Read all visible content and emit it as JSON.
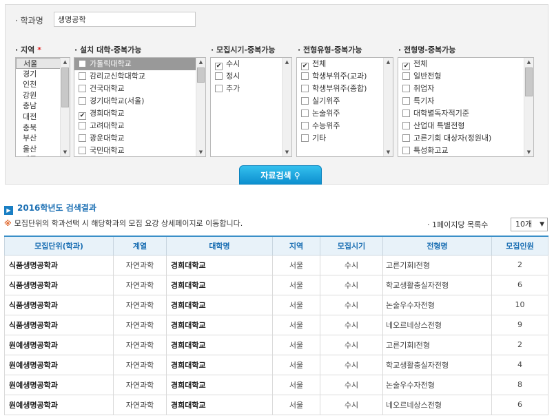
{
  "search": {
    "major_label": "학과명",
    "major_value": "생명공학"
  },
  "filters": {
    "region": {
      "title": "지역",
      "required_mark": "*",
      "items": [
        {
          "label": "서울",
          "selected": true
        },
        {
          "label": "경기",
          "selected": false
        },
        {
          "label": "인천",
          "selected": false
        },
        {
          "label": "강원",
          "selected": false
        },
        {
          "label": "충남",
          "selected": false
        },
        {
          "label": "대전",
          "selected": false
        },
        {
          "label": "충북",
          "selected": false
        },
        {
          "label": "부산",
          "selected": false
        },
        {
          "label": "울산",
          "selected": false
        },
        {
          "label": "대구",
          "selected": false
        }
      ]
    },
    "university": {
      "title": "설치 대학-중복가능",
      "items": [
        {
          "label": "가톨릭대학교",
          "checked": false,
          "highlight": true
        },
        {
          "label": "감리교신학대학교",
          "checked": false
        },
        {
          "label": "건국대학교",
          "checked": false
        },
        {
          "label": "경기대학교(서울)",
          "checked": false
        },
        {
          "label": "경희대학교",
          "checked": true
        },
        {
          "label": "고려대학교",
          "checked": false
        },
        {
          "label": "광운대학교",
          "checked": false
        },
        {
          "label": "국민대학교",
          "checked": false
        }
      ]
    },
    "period": {
      "title": "모집시기-중복가능",
      "items": [
        {
          "label": "수시",
          "checked": true
        },
        {
          "label": "정시",
          "checked": false
        },
        {
          "label": "추가",
          "checked": false
        }
      ]
    },
    "type": {
      "title": "전형유형-중복가능",
      "items": [
        {
          "label": "전체",
          "checked": true
        },
        {
          "label": "학생부위주(교과)",
          "checked": false
        },
        {
          "label": "학생부위주(종합)",
          "checked": false
        },
        {
          "label": "실기위주",
          "checked": false
        },
        {
          "label": "논술위주",
          "checked": false
        },
        {
          "label": "수능위주",
          "checked": false
        },
        {
          "label": "기타",
          "checked": false
        }
      ]
    },
    "name": {
      "title": "전형명-중복가능",
      "items": [
        {
          "label": "전체",
          "checked": true
        },
        {
          "label": "일반전형",
          "checked": false
        },
        {
          "label": "취업자",
          "checked": false
        },
        {
          "label": "특기자",
          "checked": false
        },
        {
          "label": "대학별독자적기준",
          "checked": false
        },
        {
          "label": "산업대 특별전형",
          "checked": false
        },
        {
          "label": "고른기회 대상자(정원내)",
          "checked": false
        },
        {
          "label": "특성화고교",
          "checked": false
        }
      ]
    }
  },
  "search_button": "자료검색",
  "results": {
    "title": "2016학년도 검색결과",
    "notice_mark": "※",
    "notice": "모집단위의 학과선택 시 해당학과의 모집 요강 상세페이지로 이동합니다.",
    "per_page_label": "· 1페이지당 목록수",
    "per_page_value": "10개",
    "columns": [
      "모집단위(학과)",
      "계열",
      "대학명",
      "지역",
      "모집시기",
      "전형명",
      "모집인원"
    ],
    "rows": [
      [
        "식품생명공학과",
        "자연과학",
        "경희대학교",
        "서울",
        "수시",
        "고른기회Ⅰ전형",
        "2"
      ],
      [
        "식품생명공학과",
        "자연과학",
        "경희대학교",
        "서울",
        "수시",
        "학교생활충실자전형",
        "6"
      ],
      [
        "식품생명공학과",
        "자연과학",
        "경희대학교",
        "서울",
        "수시",
        "논술우수자전형",
        "10"
      ],
      [
        "식품생명공학과",
        "자연과학",
        "경희대학교",
        "서울",
        "수시",
        "네오르네상스전형",
        "9"
      ],
      [
        "원예생명공학과",
        "자연과학",
        "경희대학교",
        "서울",
        "수시",
        "고른기회Ⅰ전형",
        "2"
      ],
      [
        "원예생명공학과",
        "자연과학",
        "경희대학교",
        "서울",
        "수시",
        "학교생활충실자전형",
        "4"
      ],
      [
        "원예생명공학과",
        "자연과학",
        "경희대학교",
        "서울",
        "수시",
        "논술우수자전형",
        "8"
      ],
      [
        "원예생명공학과",
        "자연과학",
        "경희대학교",
        "서울",
        "수시",
        "네오르네상스전형",
        "6"
      ]
    ]
  }
}
